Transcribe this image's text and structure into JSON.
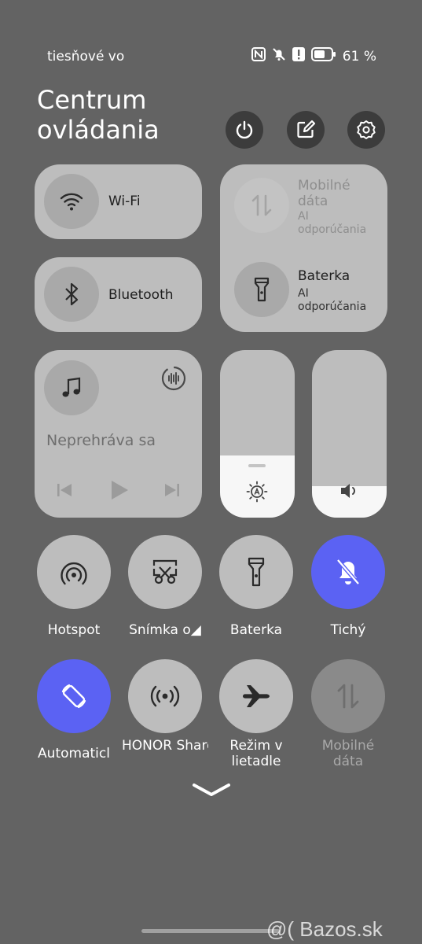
{
  "status": {
    "carrier": "tiesňové vo",
    "battery": "61 %",
    "icons": [
      "nfc-icon",
      "bell-off-icon",
      "alert-icon",
      "battery-icon"
    ]
  },
  "header": {
    "title": "Centrum ovládania",
    "buttons": [
      "power-icon",
      "edit-icon",
      "settings-icon"
    ]
  },
  "cards": {
    "wifi": {
      "label": "Wi-Fi",
      "icon": "wifi-icon"
    },
    "bluetooth": {
      "label": "Bluetooth",
      "icon": "bluetooth-icon"
    },
    "mobile": {
      "label": "Mobilné dáta",
      "sub": "AI odporúčania",
      "icon": "mobile-data-icon"
    },
    "torch": {
      "label": "Baterka",
      "sub": "AI odporúčania",
      "icon": "flashlight-icon"
    }
  },
  "media": {
    "status": "Neprehráva sa",
    "icons": [
      "music-icon",
      "audio-output-icon",
      "previous-icon",
      "play-icon",
      "next-icon"
    ]
  },
  "sliders": {
    "brightness": {
      "level": 0.37,
      "icon": "auto-brightness-icon"
    },
    "volume": {
      "level": 0.19,
      "icon": "speaker-icon"
    }
  },
  "tiles": [
    {
      "label": "Hotspot",
      "icon": "hotspot-icon",
      "state": "off"
    },
    {
      "label": "Snímka o◢",
      "icon": "screenshot-icon",
      "state": "off"
    },
    {
      "label": "Baterka",
      "icon": "flashlight-icon",
      "state": "off"
    },
    {
      "label": "Tichý",
      "icon": "silent-icon",
      "state": "on"
    },
    {
      "label": "Automaticl",
      "icon": "auto-rotate-icon",
      "state": "on"
    },
    {
      "label": "HONOR Share",
      "icon": "honor-share-icon",
      "state": "off"
    },
    {
      "label": "Režim v lietadle",
      "icon": "airplane-icon",
      "state": "off"
    },
    {
      "label": "Mobilné dáta",
      "icon": "mobile-data-icon",
      "state": "disabled"
    }
  ],
  "watermark": "@( Bazos.sk",
  "colors": {
    "background": "#636363",
    "card": "#bdbdbd",
    "accent": "#5b62f3"
  }
}
